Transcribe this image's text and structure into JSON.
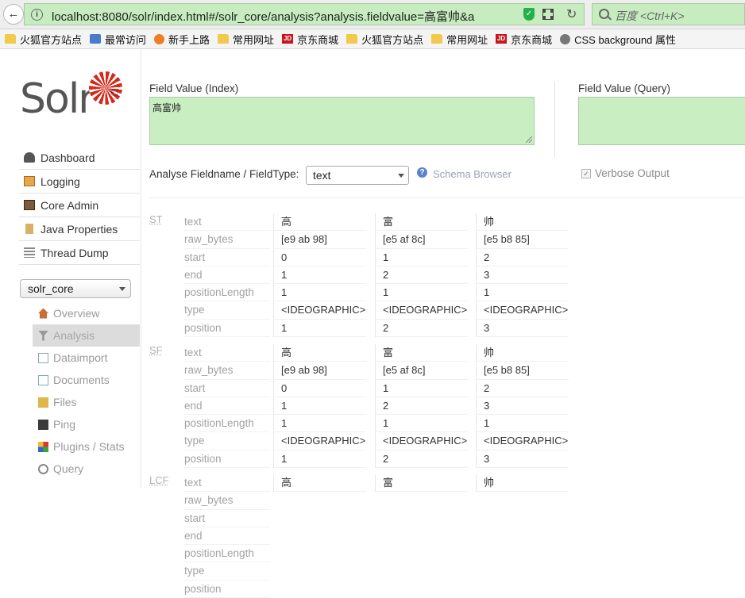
{
  "browser": {
    "url": "localhost:8080/solr/index.html#/solr_core/analysis?analysis.fieldvalue=高富帅&a",
    "search_placeholder": "百度 <Ctrl+K>",
    "bookmarks": [
      {
        "label": "火狐官方站点",
        "icon": "folder-icon"
      },
      {
        "label": "最常访问",
        "icon": "most-visited-icon"
      },
      {
        "label": "新手上路",
        "icon": "firefox-icon"
      },
      {
        "label": "常用网址",
        "icon": "folder-icon"
      },
      {
        "label": "京东商城",
        "icon": "jd-icon"
      },
      {
        "label": "火狐官方站点",
        "icon": "folder-icon"
      },
      {
        "label": "常用网址",
        "icon": "folder-icon"
      },
      {
        "label": "京东商城",
        "icon": "jd-icon"
      },
      {
        "label": "CSS background 属性",
        "icon": "globe-icon"
      }
    ]
  },
  "sidebar": {
    "logo": "Solr",
    "nav": [
      {
        "label": "Dashboard",
        "icon": "dashboard-icon"
      },
      {
        "label": "Logging",
        "icon": "logging-icon"
      },
      {
        "label": "Core Admin",
        "icon": "core-admin-icon"
      },
      {
        "label": "Java Properties",
        "icon": "java-icon"
      },
      {
        "label": "Thread Dump",
        "icon": "thread-dump-icon"
      }
    ],
    "core_selector": "solr_core",
    "core_menu": [
      {
        "label": "Overview",
        "icon": "home-icon"
      },
      {
        "label": "Analysis",
        "icon": "funnel-icon",
        "active": true
      },
      {
        "label": "Dataimport",
        "icon": "dataimport-icon"
      },
      {
        "label": "Documents",
        "icon": "documents-icon"
      },
      {
        "label": "Files",
        "icon": "files-icon"
      },
      {
        "label": "Ping",
        "icon": "ping-icon"
      },
      {
        "label": "Plugins / Stats",
        "icon": "plugins-icon"
      },
      {
        "label": "Query",
        "icon": "query-icon"
      }
    ]
  },
  "analysis": {
    "index_label": "Field Value (Index)",
    "index_value": "高富帅",
    "query_label": "Field Value (Query)",
    "query_value": "",
    "fieldtype_label": "Analyse Fieldname / FieldType:",
    "fieldtype_value": "text",
    "schema_browser": "Schema Browser",
    "verbose_label": "Verbose Output",
    "verbose_checked": true,
    "attributes": [
      "text",
      "raw_bytes",
      "start",
      "end",
      "positionLength",
      "type",
      "position"
    ],
    "stages": [
      {
        "label": "ST",
        "tokens": [
          {
            "text": "高",
            "raw_bytes": "[e9 ab 98]",
            "start": "0",
            "end": "1",
            "positionLength": "1",
            "type": "<IDEOGRAPHIC>",
            "position": "1"
          },
          {
            "text": "富",
            "raw_bytes": "[e5 af 8c]",
            "start": "1",
            "end": "2",
            "positionLength": "1",
            "type": "<IDEOGRAPHIC>",
            "position": "2"
          },
          {
            "text": "帅",
            "raw_bytes": "[e5 b8 85]",
            "start": "2",
            "end": "3",
            "positionLength": "1",
            "type": "<IDEOGRAPHIC>",
            "position": "3"
          }
        ]
      },
      {
        "label": "SF",
        "tokens": [
          {
            "text": "高",
            "raw_bytes": "[e9 ab 98]",
            "start": "0",
            "end": "1",
            "positionLength": "1",
            "type": "<IDEOGRAPHIC>",
            "position": "1"
          },
          {
            "text": "富",
            "raw_bytes": "[e5 af 8c]",
            "start": "1",
            "end": "2",
            "positionLength": "1",
            "type": "<IDEOGRAPHIC>",
            "position": "2"
          },
          {
            "text": "帅",
            "raw_bytes": "[e5 b8 85]",
            "start": "2",
            "end": "3",
            "positionLength": "1",
            "type": "<IDEOGRAPHIC>",
            "position": "3"
          }
        ]
      },
      {
        "label": "LCF",
        "tokens": [
          {
            "text": "高"
          },
          {
            "text": "富"
          },
          {
            "text": "帅"
          }
        ]
      }
    ]
  }
}
